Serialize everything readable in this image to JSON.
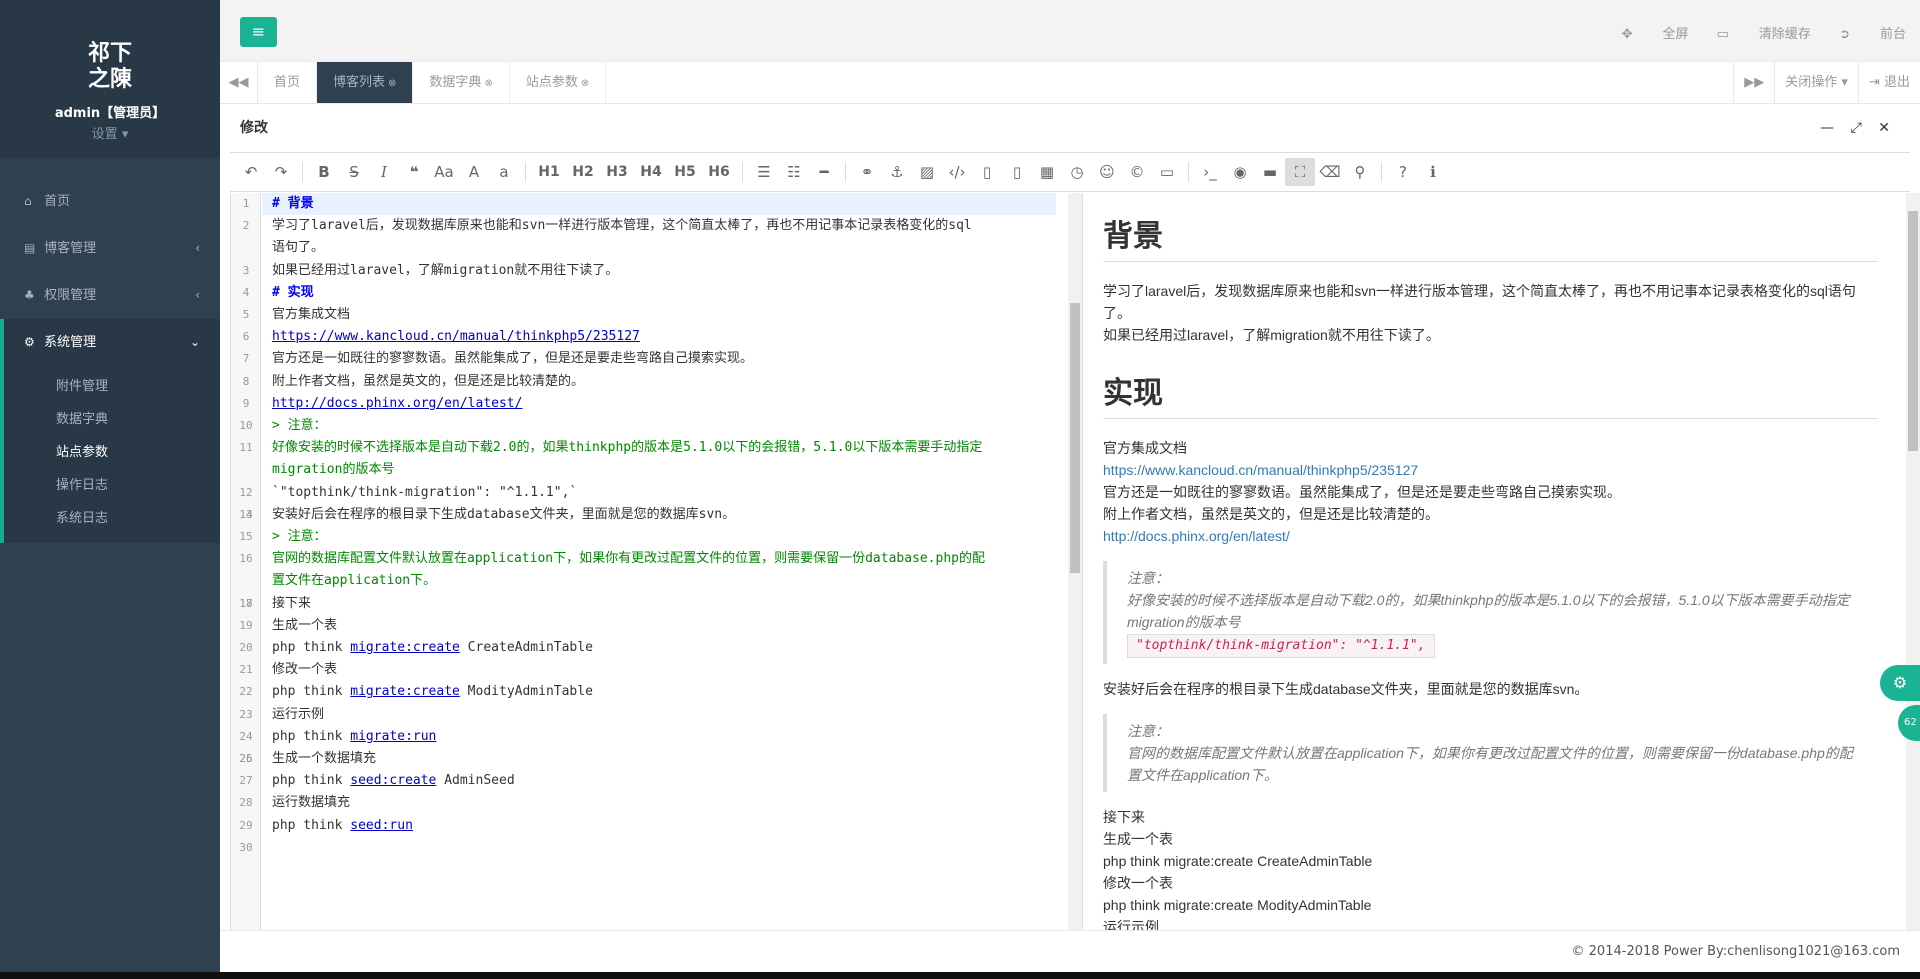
{
  "sidebar": {
    "logo_line1": "祁下",
    "logo_line2": "之陳",
    "user": "admin【管理员】",
    "settings": "设置",
    "items": [
      {
        "label": "首页",
        "icon": "home-icon"
      },
      {
        "label": "博客管理",
        "icon": "book-icon"
      },
      {
        "label": "权限管理",
        "icon": "sitemap-icon"
      },
      {
        "label": "系统管理",
        "icon": "cogs-icon"
      }
    ],
    "sub_items": [
      "附件管理",
      "数据字典",
      "站点参数",
      "操作日志",
      "系统日志"
    ]
  },
  "topbar": {
    "fullscreen": "全屏",
    "clear_cache": "清除缓存",
    "frontend": "前台"
  },
  "tabs": [
    {
      "label": "首页"
    },
    {
      "label": "博客列表"
    },
    {
      "label": "数据字典"
    },
    {
      "label": "站点参数"
    }
  ],
  "tab_actions": {
    "close_ops": "关闭操作",
    "logout": "退出"
  },
  "panel": {
    "title": "修改"
  },
  "toolbar": {
    "headings": [
      "H1",
      "H2",
      "H3",
      "H4",
      "H5",
      "H6"
    ]
  },
  "editor_lines": [
    {
      "n": "1",
      "t": "# 背景"
    },
    {
      "n": "2",
      "t": "学习了laravel后，发现数据库原来也能和svn一样进行版本管理，这个简直太棒了，再也不用记事本记录表格变化的sql"
    },
    {
      "n": "",
      "t": "语句了。"
    },
    {
      "n": "3",
      "t": "如果已经用过laravel，了解migration就不用往下读了。"
    },
    {
      "n": "4",
      "t": "# 实现"
    },
    {
      "n": "5",
      "t": "官方集成文档"
    },
    {
      "n": "6",
      "t": "https://www.kancloud.cn/manual/thinkphp5/235127"
    },
    {
      "n": "7",
      "t": "官方还是一如既往的寥寥数语。虽然能集成了，但是还是要走些弯路自己摸索实现。"
    },
    {
      "n": "8",
      "t": "附上作者文档，虽然是英文的，但是还是比较清楚的。"
    },
    {
      "n": "9",
      "t": "http://docs.phinx.org/en/latest/"
    },
    {
      "n": "10",
      "t": "> 注意："
    },
    {
      "n": "11",
      "t": "好像安装的时候不选择版本是自动下载2.0的，如果thinkphp的版本是5.1.0以下的会报错，5.1.0以下版本需要手动指定"
    },
    {
      "n": "",
      "t": "migration的版本号"
    },
    {
      "n": "12",
      "t": "`\"topthink/think-migration\": \"^1.1.1\",`"
    },
    {
      "n": "13",
      "t": ""
    },
    {
      "n": "14",
      "t": "安装好后会在程序的根目录下生成database文件夹，里面就是您的数据库svn。"
    },
    {
      "n": "15",
      "t": "> 注意："
    },
    {
      "n": "16",
      "t": "官网的数据库配置文件默认放置在application下，如果你有更改过配置文件的位置，则需要保留一份database.php的配"
    },
    {
      "n": "",
      "t": "置文件在application下。"
    },
    {
      "n": "17",
      "t": ""
    },
    {
      "n": "18",
      "t": "接下来"
    },
    {
      "n": "19",
      "t": "生成一个表"
    },
    {
      "n": "20",
      "t": "php think migrate:create CreateAdminTable"
    },
    {
      "n": "21",
      "t": "修改一个表"
    },
    {
      "n": "22",
      "t": "php think migrate:create ModityAdminTable"
    },
    {
      "n": "23",
      "t": "运行示例"
    },
    {
      "n": "24",
      "t": "php think migrate:run"
    },
    {
      "n": "25",
      "t": ""
    },
    {
      "n": "26",
      "t": "生成一个数据填充"
    },
    {
      "n": "27",
      "t": "php think seed:create AdminSeed"
    },
    {
      "n": "28",
      "t": "运行数据填充"
    },
    {
      "n": "29",
      "t": "php think seed:run"
    },
    {
      "n": "30",
      "t": ""
    }
  ],
  "preview": {
    "h1_a": "背景",
    "p_a1": "学习了laravel后，发现数据库原来也能和svn一样进行版本管理，这个简直太棒了，再也不用记事本记录表格变化的sql语句了。",
    "p_a2": "如果已经用过laravel，了解migration就不用往下读了。",
    "h1_b": "实现",
    "p_b1": "官方集成文档",
    "link1": "https://www.kancloud.cn/manual/thinkphp5/235127",
    "p_b2": "官方还是一如既往的寥寥数语。虽然能集成了，但是还是要走些弯路自己摸索实现。",
    "p_b3": "附上作者文档，虽然是英文的，但是还是比较清楚的。",
    "link2": "http://docs.phinx.org/en/latest/",
    "q1_title": "注意：",
    "q1_text": "好像安装的时候不选择版本是自动下载2.0的，如果thinkphp的版本是5.1.0以下的会报错，5.1.0以下版本需要手动指定migration的版本号",
    "q1_code": "\"topthink/think-migration\": \"^1.1.1\",",
    "p_c1": "安装好后会在程序的根目录下生成database文件夹，里面就是您的数据库svn。",
    "q2_title": "注意：",
    "q2_text": "官网的数据库配置文件默认放置在application下，如果你有更改过配置文件的位置，则需要保留一份database.php的配置文件在application下。",
    "p_d1": "接下来",
    "p_d2": "生成一个表",
    "p_d3": "php think migrate:create CreateAdminTable",
    "p_d4": "修改一个表",
    "p_d5": "php think migrate:create ModityAdminTable",
    "p_d6": "运行示例"
  },
  "footer": "© 2014-2018 Power By:chenlisong1021@163.com",
  "badge": "62"
}
